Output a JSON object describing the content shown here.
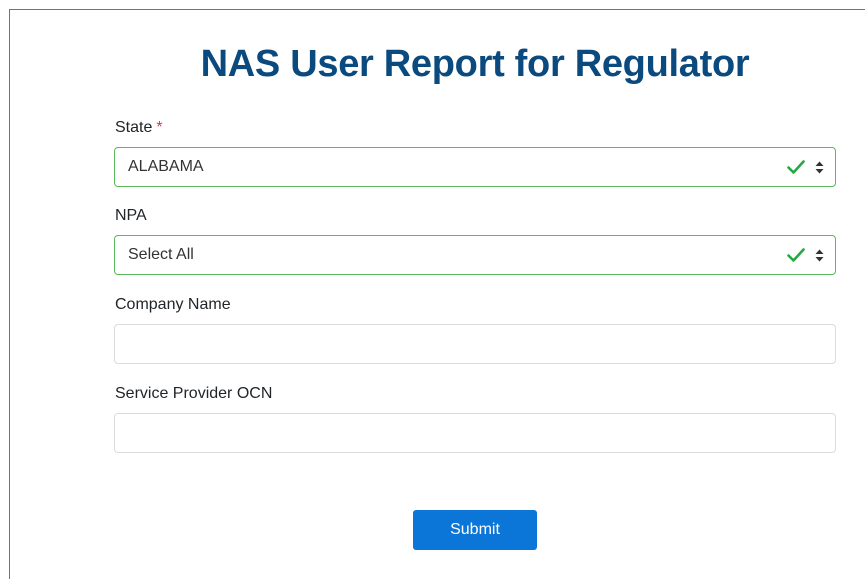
{
  "page": {
    "title": "NAS User Report for Regulator"
  },
  "form": {
    "state": {
      "label": "State",
      "required_marker": "*",
      "selected": "ALABAMA"
    },
    "npa": {
      "label": "NPA",
      "selected": "Select All"
    },
    "company_name": {
      "label": "Company Name",
      "value": ""
    },
    "service_provider_ocn": {
      "label": "Service Provider OCN",
      "value": ""
    },
    "submit_label": "Submit"
  },
  "colors": {
    "title": "#0a4a7e",
    "valid_border": "#5cb85c",
    "check": "#28a745",
    "required": "#dc3545",
    "button": "#0b76d8"
  },
  "icons": {
    "valid": "check-icon",
    "dropdown": "sort-arrows-icon"
  }
}
